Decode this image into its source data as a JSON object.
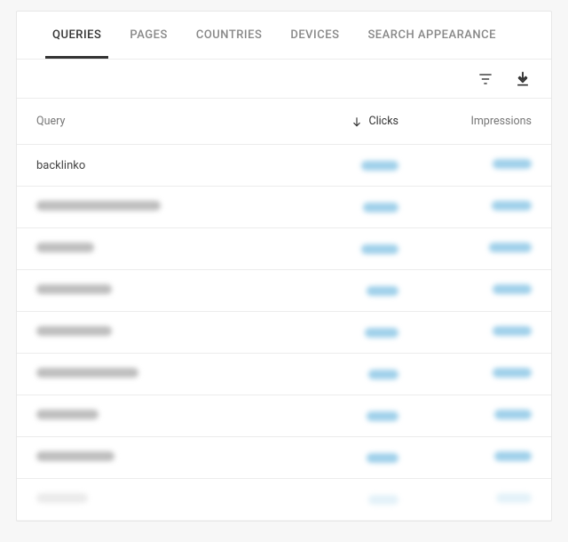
{
  "tabs": {
    "queries": "QUERIES",
    "pages": "PAGES",
    "countries": "COUNTRIES",
    "devices": "DEVICES",
    "search_appearance": "SEARCH APPEARANCE",
    "active": "queries"
  },
  "columns": {
    "query": "Query",
    "clicks": "Clicks",
    "impressions": "Impressions",
    "sorted_by": "clicks",
    "sort_direction": "desc"
  },
  "rows": [
    {
      "query": "backlinko",
      "clicks": "blurred",
      "impressions": "blurred"
    },
    {
      "query": "blurred",
      "clicks": "blurred",
      "impressions": "blurred"
    },
    {
      "query": "blurred",
      "clicks": "blurred",
      "impressions": "blurred"
    },
    {
      "query": "blurred",
      "clicks": "blurred",
      "impressions": "blurred"
    },
    {
      "query": "blurred",
      "clicks": "blurred",
      "impressions": "blurred"
    },
    {
      "query": "blurred",
      "clicks": "blurred",
      "impressions": "blurred"
    },
    {
      "query": "blurred",
      "clicks": "blurred",
      "impressions": "blurred"
    },
    {
      "query": "blurred",
      "clicks": "blurred",
      "impressions": "blurred"
    },
    {
      "query": "blurred",
      "clicks": "blurred",
      "impressions": "blurred"
    }
  ]
}
